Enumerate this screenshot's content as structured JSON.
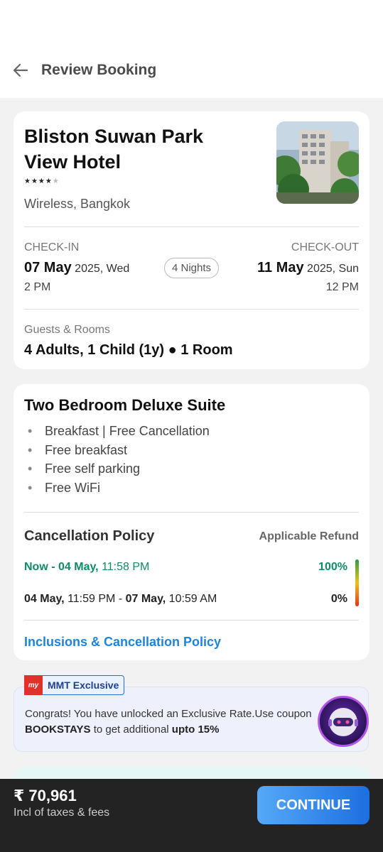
{
  "header": {
    "title": "Review Booking"
  },
  "hotel": {
    "name": "Bliston Suwan Park View Hotel",
    "stars_filled": "★★★★",
    "stars_empty": "★",
    "location": "Wireless, Bangkok",
    "checkin_label": "CHECK-IN",
    "checkin_day": "07 May",
    "checkin_rest": " 2025, Wed",
    "checkin_time": "2 PM",
    "nights": "4 Nights",
    "checkout_label": "CHECK-OUT",
    "checkout_day": "11 May",
    "checkout_rest": " 2025, Sun",
    "checkout_time": "12 PM",
    "guests_label": "Guests & Rooms",
    "guests_value": "4 Adults, 1 Child (1y) ● 1 Room"
  },
  "room": {
    "title": "Two Bedroom Deluxe Suite",
    "amenities": [
      "Breakfast | Free Cancellation",
      "Free breakfast",
      "Free self parking",
      "Free WiFi"
    ],
    "policy_title": "Cancellation Policy",
    "refund_title": "Applicable Refund",
    "policy_rows": [
      {
        "a": "Now - 04 May,",
        "b": " 11:58 PM",
        "pct": "100%"
      },
      {
        "a": "04 May,",
        "b": " 11:59 PM - ",
        "c": "07 May,",
        "d": " 10:59 AM",
        "pct": "0%"
      }
    ],
    "inclusions_link": "Inclusions & Cancellation Policy"
  },
  "exclusive": {
    "badge": "MMT Exclusive",
    "logo": "my",
    "line1": "Congrats! You have unlocked an Exclusive Rate.Use coupon",
    "code": "BOOKSTAYS",
    "mid": " to get additional ",
    "upto": "upto 15%"
  },
  "footer": {
    "price": "₹ 70,961",
    "note": "Incl of taxes & fees",
    "cta": "CONTINUE"
  },
  "colors": {
    "accent": "#1d84d9",
    "green": "#0f8a6a",
    "bar": "#232323"
  }
}
